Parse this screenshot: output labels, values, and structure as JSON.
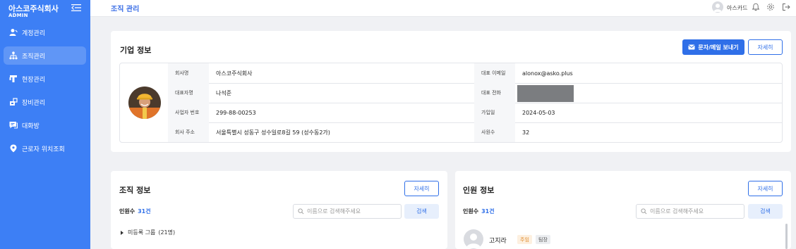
{
  "sidebar": {
    "brand": "아스코주식회사",
    "role": "ADMIN",
    "items": [
      {
        "label": "계정관리",
        "icon": "user-icon"
      },
      {
        "label": "조직관리",
        "icon": "org-chart-icon"
      },
      {
        "label": "현장관리",
        "icon": "site-icon"
      },
      {
        "label": "장비관리",
        "icon": "equipment-icon"
      },
      {
        "label": "대화방",
        "icon": "chat-icon"
      },
      {
        "label": "근로자 위치조회",
        "icon": "location-pin-icon"
      }
    ]
  },
  "topbar": {
    "title": "조직 관리",
    "user_name": "아스카드"
  },
  "company": {
    "title": "기업 정보",
    "send_button": "문자/메일 보내기",
    "detail_button": "자세히",
    "fields": {
      "name_label": "회사명",
      "name_value": "아스코주식회사",
      "ceo_label": "대표자명",
      "ceo_value": "나석준",
      "bizno_label": "사업자 번호",
      "bizno_value": "299-88-00253",
      "address_label": "회사 주소",
      "address_value": "서울특별시 성동구 성수일로8길 59 (성수동2가)",
      "email_label": "대표 이메일",
      "email_value": "alonox@asko.plus",
      "phone_label": "대표 전화",
      "phone_value": "",
      "joined_label": "가입일",
      "joined_value": "2024-05-03",
      "employees_label": "사원수",
      "employees_value": "32"
    }
  },
  "org": {
    "title": "조직 정보",
    "detail_button": "자세히",
    "count_label": "인원수",
    "count_value": "31건",
    "search_placeholder": "이름으로 검색해주세요",
    "search_button": "검색",
    "groups": [
      {
        "label": "미등록 그룹",
        "count": "(21명)"
      }
    ]
  },
  "members": {
    "title": "인원 정보",
    "detail_button": "자세히",
    "count_label": "인원수",
    "count_value": "31건",
    "search_placeholder": "이름으로 검색해주세요",
    "search_button": "검색",
    "list": [
      {
        "name": "고지라",
        "badge1": "주임",
        "badge2": "팀장"
      }
    ]
  },
  "colors": {
    "primary": "#2f6fe8",
    "sidebar": "#3d7ff5"
  }
}
